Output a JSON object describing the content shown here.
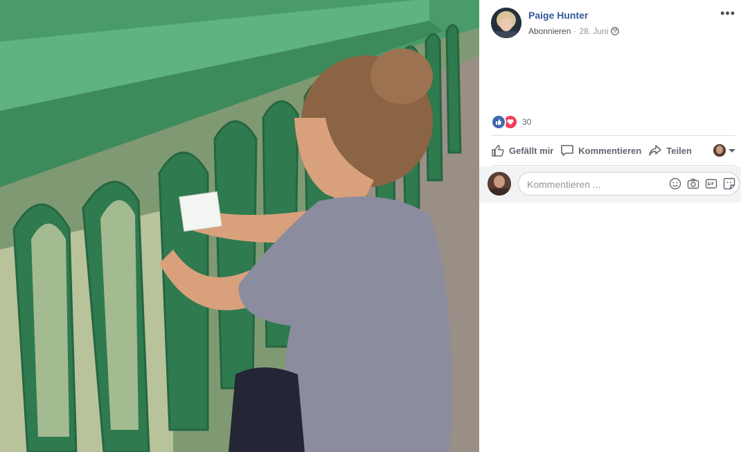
{
  "post": {
    "author": "Paige Hunter",
    "follow_label": "Abonnieren",
    "separator": "·",
    "date": "28. Juni",
    "more_label": "•••"
  },
  "reactions": {
    "count": "30",
    "types": [
      "like-icon",
      "love-icon"
    ]
  },
  "actions": {
    "like_label": "Gefällt mir",
    "comment_label": "Kommentieren",
    "share_label": "Teilen"
  },
  "comment": {
    "placeholder": "Kommentieren ..."
  },
  "icons": {
    "emoji": "emoji-icon",
    "camera": "camera-icon",
    "gif": "gif-icon",
    "sticker": "sticker-icon"
  },
  "colors": {
    "link": "#365899",
    "like": "#4267b2",
    "love": "#f33e58",
    "railing": "#3f8d5c"
  }
}
